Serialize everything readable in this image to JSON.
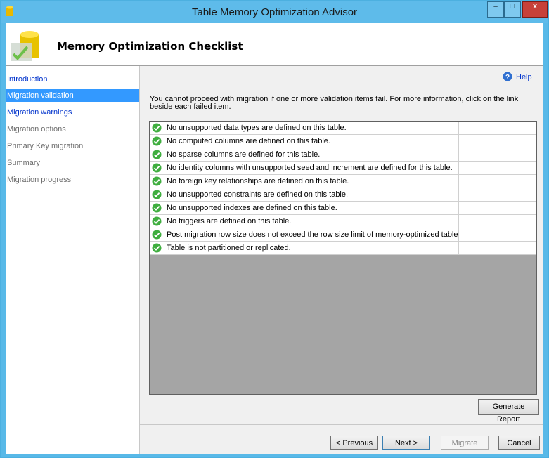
{
  "window": {
    "title": "Table Memory Optimization Advisor",
    "minimize": "–",
    "maximize": "□",
    "close": "x"
  },
  "header": {
    "title": "Memory Optimization Checklist"
  },
  "nav": {
    "items": [
      {
        "label": "Introduction"
      },
      {
        "label": "Migration validation"
      },
      {
        "label": "Migration warnings"
      },
      {
        "label": "Migration options"
      },
      {
        "label": "Primary Key migration"
      },
      {
        "label": "Summary"
      },
      {
        "label": "Migration progress"
      }
    ],
    "selected": "Migration validation"
  },
  "main": {
    "help_label": "Help",
    "message": "You cannot proceed with migration if one or more validation items fail. For more information, click on the link beside each failed item.",
    "checks": [
      "No unsupported data types are defined on this table.",
      "No computed columns are defined on this table.",
      "No sparse columns are defined for this table.",
      "No identity columns with unsupported seed and increment are defined for this table.",
      "No foreign key relationships are defined on this table.",
      "No unsupported constraints are defined on this table.",
      "No unsupported indexes are defined on this table.",
      "No triggers are defined on this table.",
      "Post migration row size does not exceed the row size limit of memory-optimized tables.",
      "Table is not partitioned or replicated."
    ],
    "generate_report": "Generate Report"
  },
  "footer": {
    "previous": "< Previous",
    "next": "Next >",
    "migrate": "Migrate",
    "cancel": "Cancel"
  },
  "colors": {
    "selection": "#3399ff",
    "link": "#0033cc",
    "titlebar": "#5ebbea",
    "check": "#3fae3f"
  }
}
